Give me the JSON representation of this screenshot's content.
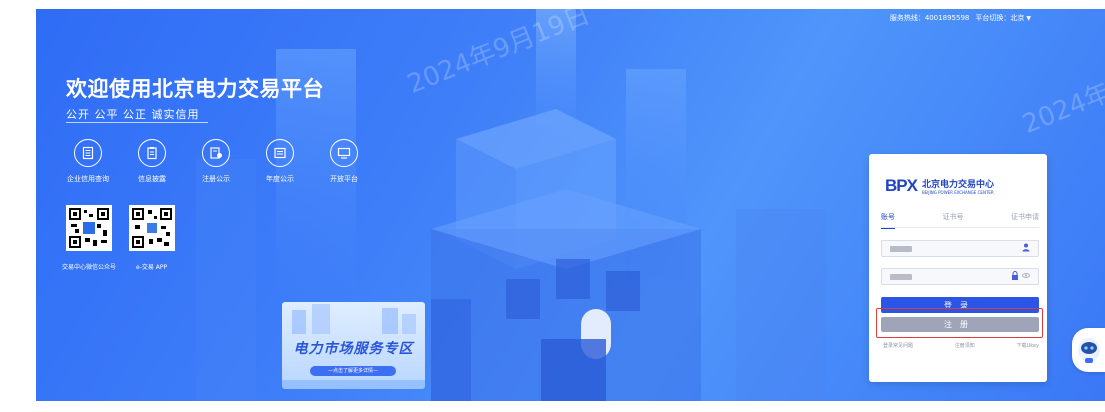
{
  "header": {
    "hotline_label": "服务热线：4001895598",
    "platform_switch_label": "平台切换：北京"
  },
  "watermark": {
    "text": "2024年9月19日"
  },
  "hero": {
    "title": "欢迎使用北京电力交易平台",
    "slogan": "公开 公平 公正 诚实信用"
  },
  "quick_links": [
    {
      "label": "企业信用查询",
      "icon": "document-list-icon"
    },
    {
      "label": "信息披露",
      "icon": "clipboard-icon"
    },
    {
      "label": "注册公示",
      "icon": "registration-icon"
    },
    {
      "label": "年度公示",
      "icon": "annual-report-icon"
    },
    {
      "label": "开放平台",
      "icon": "monitor-icon"
    }
  ],
  "qr_codes": [
    {
      "label": "交易中心微信公众号"
    },
    {
      "label": "e-交易 APP"
    }
  ],
  "promo": {
    "title": "电力市场服务专区",
    "subtitle": "—点击了解更多详情—"
  },
  "login": {
    "logo_mark": "BPX",
    "logo_cn": "北京电力交易中心",
    "logo_en": "BEIJING POWER EXCHANGE CENTER",
    "tabs": [
      {
        "label": "账号",
        "active": true
      },
      {
        "label": "证书号",
        "active": false
      },
      {
        "label": "证书申请",
        "active": false
      }
    ],
    "login_button": "登录",
    "register_button": "注册",
    "links": [
      "登录常见问题",
      "注册须知",
      "下载Ukey"
    ]
  },
  "colors": {
    "banner_blue": "#3f7ff8",
    "primary_button": "#2a55e6",
    "register_button": "#a0a4b8",
    "highlight_border": "#e03a3a"
  }
}
